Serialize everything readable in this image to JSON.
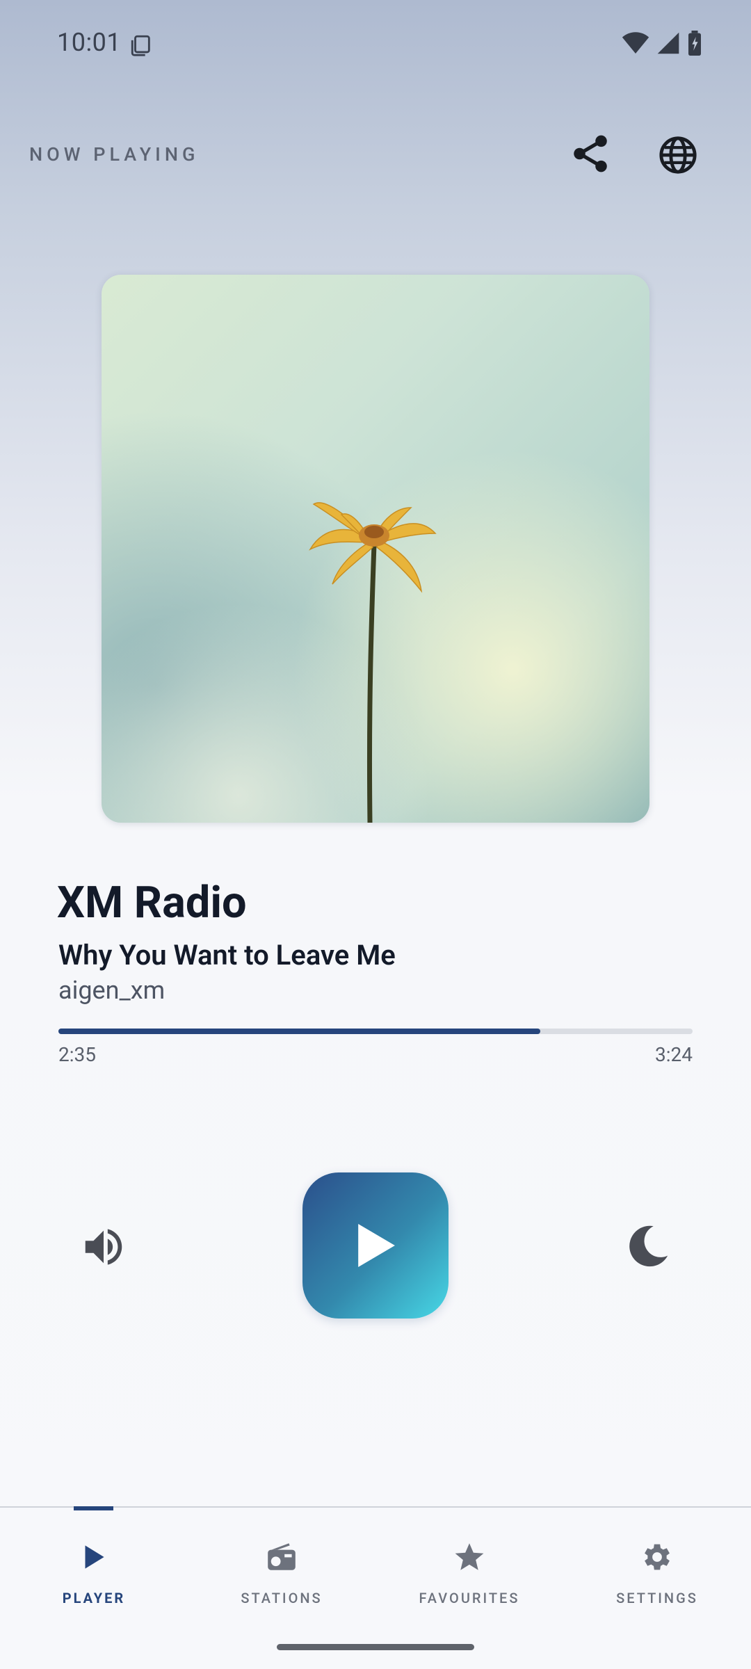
{
  "status_bar": {
    "time": "10:01",
    "icons": [
      "sim-card-icon",
      "wifi-icon",
      "cellular-signal-icon",
      "battery-charging-icon"
    ]
  },
  "header": {
    "title": "NOW PLAYING",
    "share_icon": "share-icon",
    "globe_icon": "globe-icon"
  },
  "now_playing": {
    "station": "XM Radio",
    "track_title": "Why You Want to Leave Me",
    "artist": "aigen_xm",
    "elapsed": "2:35",
    "total": "3:24",
    "progress_fraction": 0.76
  },
  "controls": {
    "volume_icon": "volume-icon",
    "play_icon": "play-icon",
    "sleep_icon": "moon-icon"
  },
  "nav": {
    "items": [
      {
        "label": "PLAYER",
        "icon": "play-icon",
        "active": true
      },
      {
        "label": "STATIONS",
        "icon": "radio-icon",
        "active": false
      },
      {
        "label": "FAVOURITES",
        "icon": "star-icon",
        "active": false
      },
      {
        "label": "SETTINGS",
        "icon": "gear-icon",
        "active": false
      }
    ]
  },
  "colors": {
    "accent": "#26457c",
    "play_gradient_start": "#2b4f8b",
    "play_gradient_end": "#47d8e6",
    "text_primary": "#131a29",
    "icon_gray": "#4a4d55"
  }
}
